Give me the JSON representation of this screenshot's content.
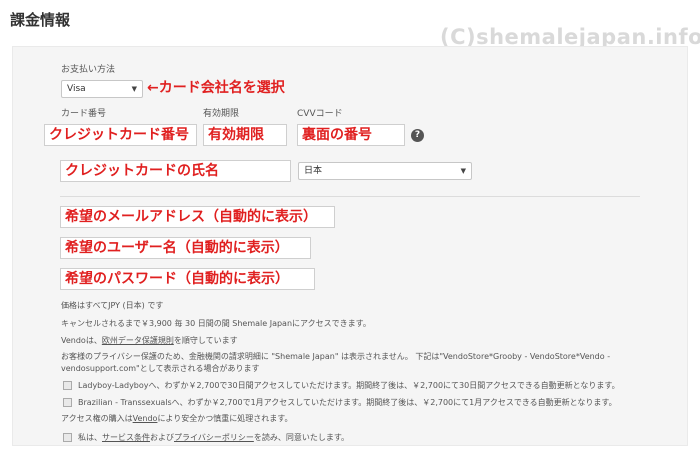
{
  "page_title": "課金情報",
  "watermark": "(C)shemalejapan.info",
  "form": {
    "payment_method_label": "お支払い方法",
    "payment_method_value": "Visa",
    "payment_method_annotation": "←カード会社名を選択",
    "card_number_label": "カード番号",
    "card_number_annotation": "クレジットカード番号",
    "expiry_label": "有効期限",
    "expiry_annotation": "有効期限",
    "cvv_label": "CVVコード",
    "cvv_annotation": "裏面の番号",
    "help_icon_glyph": "?",
    "cardholder_annotation": "クレジットカードの氏名",
    "country_value": "日本",
    "email_annotation": "希望のメールアドレス（自動的に表示）",
    "username_annotation": "希望のユーザー名（自動的に表示）",
    "password_annotation": "希望のパスワード（自動的に表示）"
  },
  "notes": {
    "currency": "価格はすべてJPY (日本) です",
    "cancel": "キャンセルされるまで￥3,900 毎 30 日間の間 Shemale Japanにアクセスできます。",
    "vendo_prefix": "Vendoは、",
    "vendo_link": "欧州データ保護規則",
    "vendo_suffix": "を順守しています",
    "privacy_line1": "お客様のプライバシー保護のため、金融機関の請求明細に \"Shemale Japan\" は表示されません。 下記は\"VendoStore*Grooby - VendoStore*Vendo -",
    "privacy_line2": "vendosupport.com\"として表示される場合があります",
    "option1": "Ladyboy-Ladyboyへ、わずか￥2,700で30日間アクセスしていただけます。期間終了後は、￥2,700にて30日間アクセスできる自動更新となります。",
    "option2": "Brazilian - Transsexualsへ、わずか￥2,700で1月アクセスしていただけます。期間終了後は、￥2,700にて1月アクセスできる自動更新となります。",
    "access_prefix": "アクセス権の購入は",
    "access_link": "Vendo",
    "access_suffix": "により安全かつ慎重に処理されます。",
    "terms_prefix": "私は、",
    "terms_link1": "サービス条件",
    "terms_mid": "および",
    "terms_link2": "プライバシーポリシー",
    "terms_suffix": "を読み、同意いたします。"
  }
}
